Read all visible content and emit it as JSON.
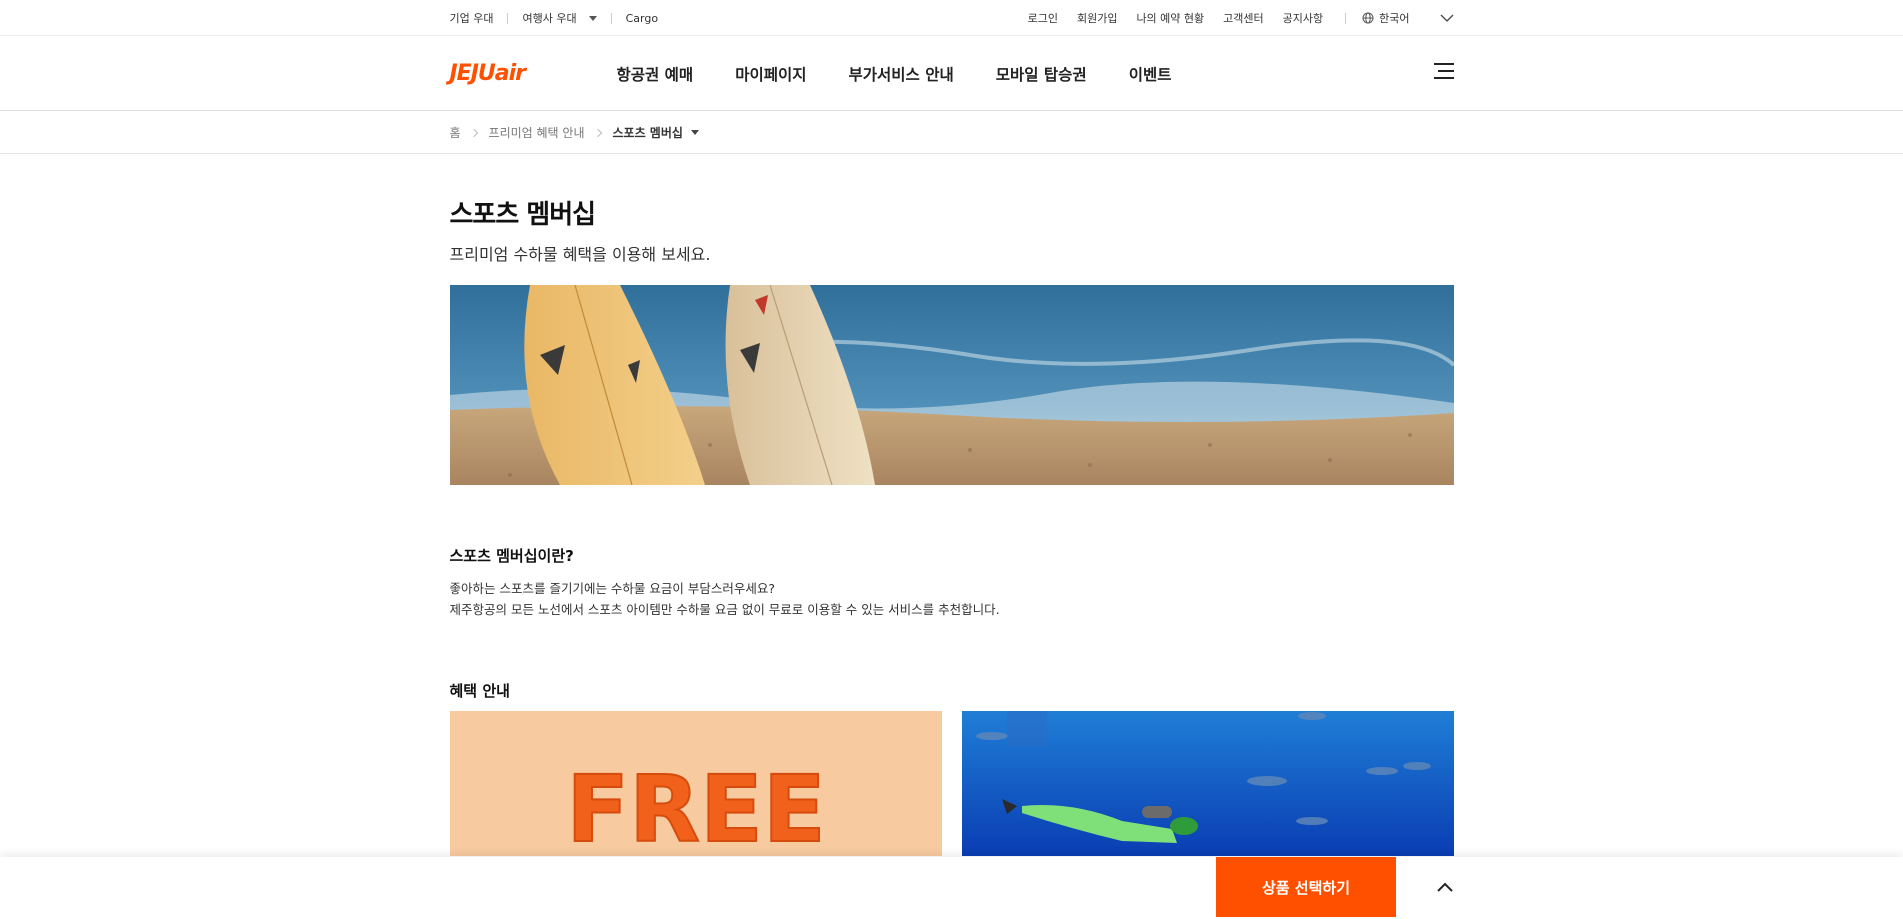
{
  "util": {
    "left": [
      "기업 우대",
      "여행사 우대",
      "Cargo"
    ],
    "right": [
      "로그인",
      "회원가입",
      "나의 예약 현황",
      "고객센터",
      "공지사항"
    ],
    "language": "한국어"
  },
  "header": {
    "logo": "JEJUair",
    "menus": [
      "항공권 예매",
      "마이페이지",
      "부가서비스 안내",
      "모바일 탑승권",
      "이벤트"
    ]
  },
  "breadcrumb": {
    "home": "홈",
    "parent": "프리미엄 혜택 안내",
    "current": "스포츠 멤버십"
  },
  "content": {
    "title": "스포츠 멤버십",
    "subtitle": "프리미엄 수하물 혜택을 이용해 보세요.",
    "about_title": "스포츠 멤버십이란?",
    "about_line1": "좋아하는 스포츠를 즐기기에는 수하물 요금이 부담스러우세요?",
    "about_line2": "제주항공의 모든 노선에서 스포츠 아이템만 수하물 요금 없이 무료로 이용할 수 있는 서비스를 추천합니다.",
    "benefit_title": "혜택 안내",
    "free_text": "FREE"
  },
  "bottom": {
    "cta": "상품 선택하기"
  },
  "colors": {
    "brand": "#ff5000"
  }
}
